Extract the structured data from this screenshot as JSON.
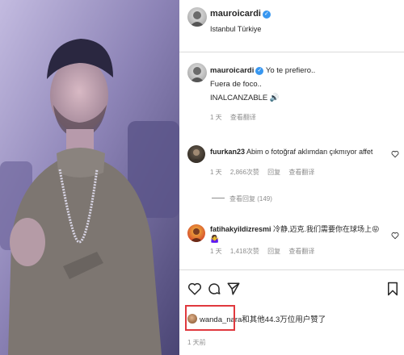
{
  "post": {
    "author": "mauroicardi",
    "location": "Istanbul Türkiye",
    "caption": {
      "line1": "Yo te prefiero..",
      "line2": "Fuera de foco..",
      "line3": "INALCANZABLE",
      "emoji": "🔊",
      "age": "1 天",
      "translate": "查看翻译"
    }
  },
  "comments": [
    {
      "user": "fuurkan23",
      "text": "Abim o fotoğraf aklımdan çıkmıyor affet",
      "age": "1 天",
      "likes": "2,866次赞",
      "reply": "回复",
      "translate": "查看翻译"
    },
    {
      "user": "fatihakyildizresmi",
      "text": "冷静,迈克.我们需要你在球场上😝🤷‍♀️",
      "age": "1 天",
      "likes": "1,418次赞",
      "reply": "回复",
      "translate": "查看翻译"
    }
  ],
  "view_replies": "查看回复 (149)",
  "likes": {
    "user": "wanda_nara",
    "text": "和其他44.3万位用户赞了"
  },
  "timestamp": "1 天前",
  "icons": {
    "like": "heart-icon",
    "comment": "comment-icon",
    "share": "paper-plane-icon",
    "save": "bookmark-icon",
    "verified": "verified-badge-icon"
  },
  "colors": {
    "verified": "#3897f0",
    "highlight": "#e0393e",
    "muted": "#8e8e8e"
  }
}
